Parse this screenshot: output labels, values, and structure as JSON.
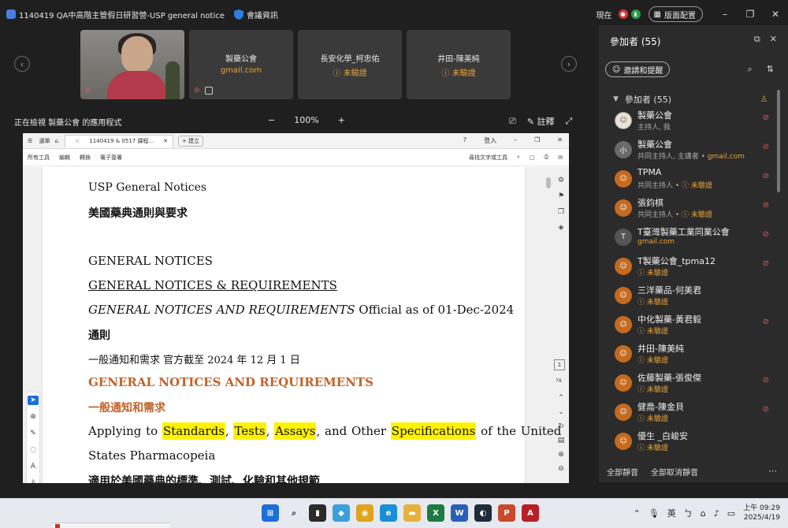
{
  "titlebar": {
    "title": "1140419 QA中高階主管假日研習營-USP general notice",
    "meeting_info": "會議資訊",
    "now_label": "現在",
    "layout_button": "版面配置"
  },
  "video_tiles": [
    {
      "name": "",
      "sub": ""
    },
    {
      "name": "製藥公會",
      "sub": "gmail.com"
    },
    {
      "name": "長安化學_柯忠佑",
      "sub": "未驗證"
    },
    {
      "name": "井田-陳美純",
      "sub": "未驗證"
    }
  ],
  "share": {
    "label": "正在檢視 製藥公會 的應用程式",
    "zoom_minus": "−",
    "zoom_value": "100%",
    "zoom_plus": "+",
    "annotate_label": "註釋"
  },
  "doc_window": {
    "tab_home": "選單",
    "tab_title": "1140419 & 0517 課程...",
    "new_tab": "+ 建立",
    "sign_in": "登入",
    "toolbar_menus": [
      "所有工具",
      "編輯",
      "轉換",
      "電子簽署"
    ],
    "search_tools": "尋找文字或工具",
    "page_current": "1",
    "page_total": "78"
  },
  "document": {
    "line_title": "USP    General Notices",
    "line_cn_title": "美國藥典通則與要求",
    "line_gn": "GENERAL NOTICES",
    "line_gnr": "GENERAL NOTICES & REQUIREMENTS",
    "line_official_italic": "GENERAL NOTICES AND REQUIREMENTS",
    "line_official_rest": " Official as of 01-Dec-2024",
    "line_tongze": "通則",
    "line_yiban": "一般通知和需求 官方截至 2024 年 12 月 1 日",
    "line_gnr2": "GENERAL NOTICES AND REQUIREMENTS",
    "line_yiban2": "一般通知和需求",
    "apply_prefix": "Applying to ",
    "hl_standards": "Standards",
    "comma1": ", ",
    "hl_tests": "Tests",
    "comma2": ", ",
    "hl_assays": "Assays",
    "and_other": ", and Other ",
    "hl_specifications": "Specifications",
    "of_the_united": " of the United",
    "line_states": "States Pharmacopeia",
    "line_cnapply": "適用於美國藥典的標準、測試、化驗和其他規範"
  },
  "panel": {
    "title": "參加者 (55)",
    "invite": "邀請和提醒",
    "group_label": "參加者 (55)",
    "mute_all": "全部靜音",
    "unmute_all": "全部取消靜音",
    "participants": [
      {
        "name": "製藥公會",
        "role": "主持人, 我",
        "avatar": "",
        "avatar_style": "photo"
      },
      {
        "name": "製藥公會",
        "role": "共同主持人, 主講者 • ",
        "domain": "gmail.com",
        "avatar": "小",
        "avatar_style": "dark"
      },
      {
        "name": "TPMA",
        "role": "共同主持人 • ",
        "warn": "未驗證",
        "avatar": "",
        "avatar_style": "orange"
      },
      {
        "name": "張鈞棋",
        "role": "共同主持人 • ",
        "warn": "未驗證",
        "avatar": "",
        "avatar_style": "orange"
      },
      {
        "name": "T臺灣製藥工業同業公會",
        "role": "",
        "domain": "gmail.com",
        "avatar": "T",
        "avatar_style": "grey"
      },
      {
        "name": "T製藥公會_tpma12",
        "role": "",
        "warn": "未驗證",
        "avatar": "",
        "avatar_style": "orange"
      },
      {
        "name": "三洋藥品-何美君",
        "role": "",
        "warn": "未驗證",
        "avatar": "",
        "avatar_style": "orange"
      },
      {
        "name": "中化製藥-黃君毅",
        "role": "",
        "warn": "未驗證",
        "avatar": "",
        "avatar_style": "orange"
      },
      {
        "name": "井田-陳美純",
        "role": "",
        "warn": "未驗證",
        "avatar": "",
        "avatar_style": "orange"
      },
      {
        "name": "佐藤製藥-張俊傑",
        "role": "",
        "warn": "未驗證",
        "avatar": "",
        "avatar_style": "orange"
      },
      {
        "name": "健喬-陳金貝",
        "role": "",
        "warn": "未驗證",
        "avatar": "",
        "avatar_style": "orange"
      },
      {
        "name": "優生 _白峻安",
        "role": "",
        "warn": "未驗證",
        "avatar": "",
        "avatar_style": "orange"
      }
    ]
  },
  "taskbar": {
    "ime": "英",
    "time": "上午 09:29",
    "date": "2025/4/19"
  },
  "colors": {
    "accent_orange": "#e7a33c",
    "doc_heading_orange": "#c0632a",
    "highlight": "#fff200",
    "mute_red": "#e05a5a"
  }
}
